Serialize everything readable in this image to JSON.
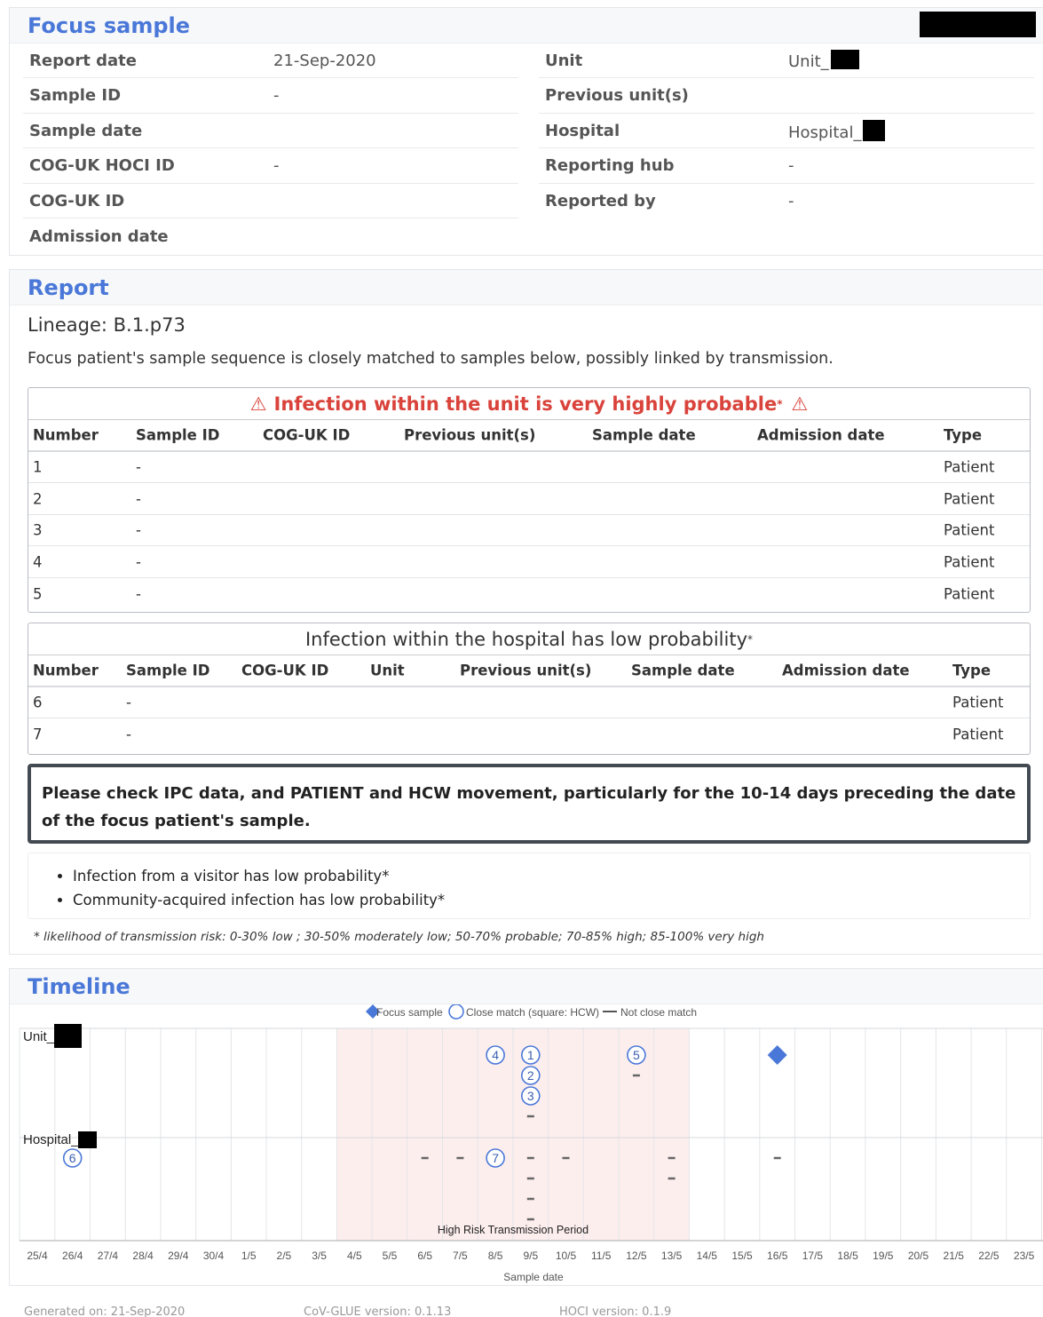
{
  "focus": {
    "title": "Focus sample",
    "left": [
      {
        "k": "Report date",
        "v": "21-Sep-2020"
      },
      {
        "k": "Sample ID",
        "v": "-"
      },
      {
        "k": "Sample date",
        "v": ""
      },
      {
        "k": "COG-UK HOCI ID",
        "v": "-"
      },
      {
        "k": "COG-UK ID",
        "v": ""
      },
      {
        "k": "Admission date",
        "v": ""
      }
    ],
    "right": [
      {
        "k": "Unit",
        "v": "Unit_"
      },
      {
        "k": "Previous unit(s)",
        "v": ""
      },
      {
        "k": "Hospital",
        "v": "Hospital_"
      },
      {
        "k": "Reporting hub",
        "v": "-"
      },
      {
        "k": "Reported by",
        "v": "-"
      }
    ]
  },
  "report": {
    "title": "Report",
    "lineage": "Lineage: B.1.p73",
    "subtitle": "Focus patient's sample sequence is closely matched to samples below, possibly linked by transmission.",
    "table1": {
      "caption": "Infection within the unit is very highly probable",
      "caption_mark": "*",
      "warning_glyph": "⚠",
      "headers": [
        "Number",
        "Sample ID",
        "COG-UK ID",
        "Previous unit(s)",
        "Sample date",
        "Admission date",
        "Type"
      ],
      "rows": [
        [
          "1",
          "-",
          "",
          "",
          "",
          "",
          "Patient"
        ],
        [
          "2",
          "-",
          "",
          "",
          "",
          "",
          "Patient"
        ],
        [
          "3",
          "-",
          "",
          "",
          "",
          "",
          "Patient"
        ],
        [
          "4",
          "-",
          "",
          "",
          "",
          "",
          "Patient"
        ],
        [
          "5",
          "-",
          "",
          "",
          "",
          "",
          "Patient"
        ]
      ]
    },
    "table2": {
      "caption": "Infection within the hospital has low probability",
      "caption_mark": "*",
      "headers": [
        "Number",
        "Sample ID",
        "COG-UK ID",
        "Unit",
        "Previous unit(s)",
        "Sample date",
        "Admission date",
        "Type"
      ],
      "rows": [
        [
          "6",
          "-",
          "",
          "",
          "",
          "",
          "",
          "Patient"
        ],
        [
          "7",
          "-",
          "",
          "",
          "",
          "",
          "",
          "Patient"
        ]
      ]
    },
    "notice": "Please check IPC data, and PATIENT and HCW movement, particularly for the 10-14 days preceding the date of the focus patient's sample.",
    "bullets": [
      "Infection from a visitor has low probability*",
      "Community-acquired infection has low probability*"
    ],
    "footnote": "* likelihood of transmission risk: 0-30% low ; 30-50% moderately low; 50-70% probable; 70-85% high; 85-100% very high"
  },
  "timeline": {
    "title": "Timeline",
    "legend": {
      "focus": "Focus sample",
      "close": "Close match (square: HCW)",
      "not_close": "Not close match"
    },
    "rows": [
      "Unit_",
      "Hospital_"
    ],
    "dates": [
      "25/4",
      "26/4",
      "27/4",
      "28/4",
      "29/4",
      "30/4",
      "1/5",
      "2/5",
      "3/5",
      "4/5",
      "5/5",
      "6/5",
      "7/5",
      "8/5",
      "9/5",
      "10/5",
      "11/5",
      "12/5",
      "13/5",
      "14/5",
      "15/5",
      "16/5",
      "17/5",
      "18/5",
      "19/5",
      "20/5",
      "21/5",
      "22/5",
      "23/5"
    ],
    "high_risk_label": "High Risk Transmission Period",
    "high_risk_start_index": 9,
    "high_risk_end_index": 18,
    "xlabel": "Sample date",
    "focus": {
      "row": 0,
      "date_index": 21
    },
    "close_matches": [
      {
        "n": "1",
        "row": 0,
        "date_index": 14,
        "stack": 0
      },
      {
        "n": "2",
        "row": 0,
        "date_index": 14,
        "stack": 1
      },
      {
        "n": "3",
        "row": 0,
        "date_index": 14,
        "stack": 2
      },
      {
        "n": "4",
        "row": 0,
        "date_index": 13,
        "stack": 0
      },
      {
        "n": "5",
        "row": 0,
        "date_index": 17,
        "stack": 0
      },
      {
        "n": "6",
        "row": 1,
        "date_index": 1,
        "stack": 0
      },
      {
        "n": "7",
        "row": 1,
        "date_index": 13,
        "stack": 0
      }
    ],
    "not_close": [
      {
        "row": 0,
        "date_index": 14,
        "stack": 3
      },
      {
        "row": 0,
        "date_index": 17,
        "stack": 1
      },
      {
        "row": 1,
        "date_index": 11,
        "stack": 0
      },
      {
        "row": 1,
        "date_index": 12,
        "stack": 0
      },
      {
        "row": 1,
        "date_index": 14,
        "stack": 0
      },
      {
        "row": 1,
        "date_index": 14,
        "stack": 1
      },
      {
        "row": 1,
        "date_index": 14,
        "stack": 2
      },
      {
        "row": 1,
        "date_index": 14,
        "stack": 3
      },
      {
        "row": 1,
        "date_index": 15,
        "stack": 0
      },
      {
        "row": 1,
        "date_index": 18,
        "stack": 0
      },
      {
        "row": 1,
        "date_index": 18,
        "stack": 1
      },
      {
        "row": 1,
        "date_index": 21,
        "stack": 0
      }
    ],
    "colors": {
      "accent": "#4a78d8",
      "high_risk": "#fdeeee",
      "grid": "#e3e5e8"
    }
  },
  "footer": {
    "generated": "Generated on: 21-Sep-2020",
    "cov_glue": "CoV-GLUE version: 0.1.13",
    "hoci": "HOCI version: 0.1.9"
  }
}
